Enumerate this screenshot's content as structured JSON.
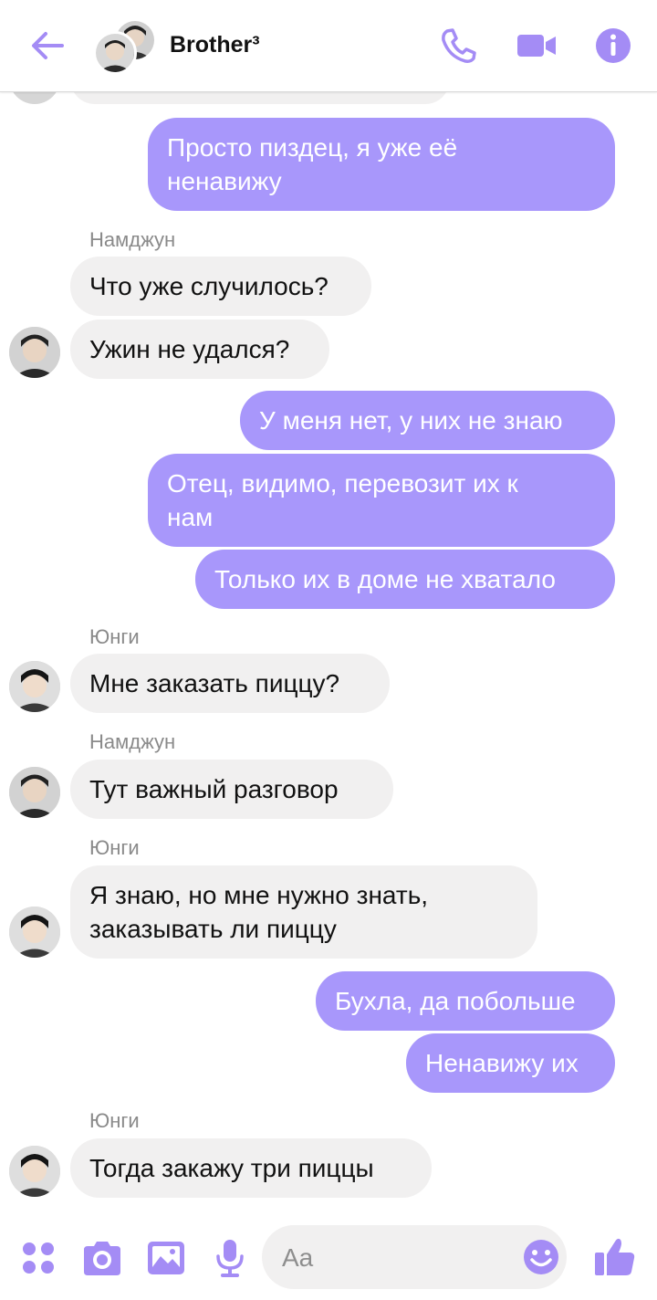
{
  "header": {
    "title": "Brother³",
    "back_icon": "arrow-left-icon",
    "call_icon": "phone-icon",
    "video_icon": "video-camera-icon",
    "info_icon": "info-icon"
  },
  "colors": {
    "accent": "#a48cf5",
    "outgoing_bubble": "#a897fb",
    "incoming_bubble": "#f1f0f0",
    "sender_name": "#8a8a8a"
  },
  "messages": [
    {
      "text": "Просто пиздец, я уже её",
      "text2": "ненавижу"
    },
    {
      "sender": "Намджун"
    },
    {
      "text": "Что уже случилось?"
    },
    {
      "text": "Ужин не удался?"
    },
    {
      "text": "У меня нет, у них не знаю"
    },
    {
      "text": "Отец, видимо, перевозит их к",
      "text2": "нам"
    },
    {
      "text": "Только их в доме не хватало"
    },
    {
      "sender": "Юнги"
    },
    {
      "text": "Мне заказать пиццу?"
    },
    {
      "sender": "Намджун"
    },
    {
      "text": "Тут важный разговор"
    },
    {
      "sender": "Юнги"
    },
    {
      "text": "Я знаю, но мне нужно знать,",
      "text2": "заказывать ли пиццу"
    },
    {
      "text": "Бухла, да побольше"
    },
    {
      "text": "Ненавижу их"
    },
    {
      "sender": "Юнги"
    },
    {
      "text": "Тогда закажу три пиццы"
    }
  ],
  "composer": {
    "placeholder": "Aa",
    "menu_icon": "four-dots-icon",
    "camera_icon": "camera-icon",
    "gallery_icon": "image-icon",
    "mic_icon": "microphone-icon",
    "emoji_icon": "smiley-icon",
    "like_icon": "thumbs-up-icon"
  }
}
